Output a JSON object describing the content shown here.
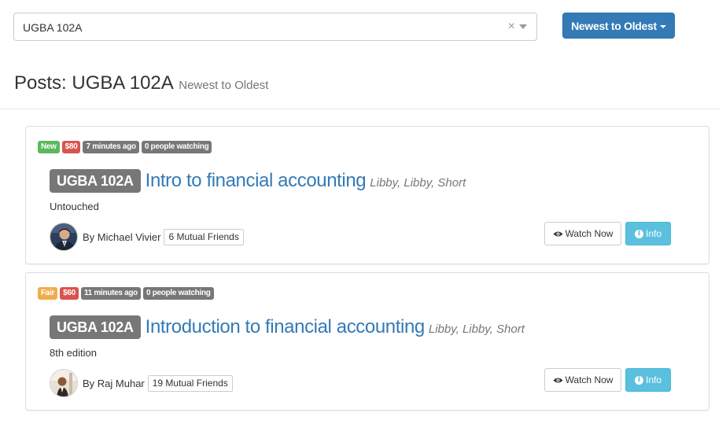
{
  "search": {
    "value": "UGBA 102A",
    "clear_glyph": "×"
  },
  "sort": {
    "label": "Newest to Oldest"
  },
  "heading": {
    "prefix": "Posts: UGBA 102A",
    "subtitle": "Newest to Oldest"
  },
  "colors": {
    "primary": "#337ab7",
    "success": "#5cb85c",
    "warning": "#f0ad4e",
    "danger": "#d9534f",
    "default": "#777777",
    "info": "#5bc0de"
  },
  "posts": [
    {
      "badges": {
        "condition": {
          "text": "New",
          "style": "success"
        },
        "price": "$80",
        "time": "7 minutes ago",
        "watching": "0 people watching"
      },
      "course": "UGBA 102A",
      "title": "Intro to financial accounting",
      "authors": "Libby, Libby, Short",
      "condition_text": "Untouched",
      "seller": "By Michael Vivier",
      "mutual_friends": "6 Mutual Friends",
      "watch_label": "Watch Now",
      "info_label": "Info"
    },
    {
      "badges": {
        "condition": {
          "text": "Fair",
          "style": "warning"
        },
        "price": "$60",
        "time": "11 minutes ago",
        "watching": "0 people watching"
      },
      "course": "UGBA 102A",
      "title": "Introduction to financial accounting",
      "authors": "Libby, Libby, Short",
      "condition_text": "8th edition",
      "seller": "By Raj Muhar",
      "mutual_friends": "19 Mutual Friends",
      "watch_label": "Watch Now",
      "info_label": "Info"
    }
  ]
}
